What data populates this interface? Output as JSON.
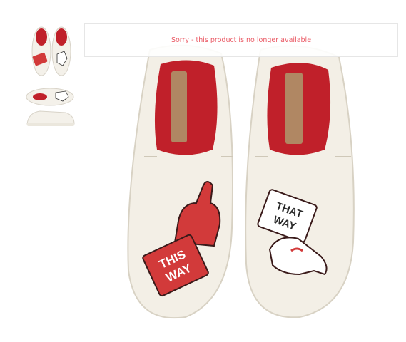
{
  "gallery": {
    "thumbnails": [
      {
        "name": "thumbnail-top-view"
      },
      {
        "name": "thumbnail-side-view"
      }
    ]
  },
  "notice": {
    "text": "Sorry - this product is no longer available",
    "color": "#ea5863"
  },
  "product": {
    "left_print": {
      "line1": "THIS",
      "line2": "WAY"
    },
    "right_print": {
      "line1": "THAT",
      "line2": "WAY"
    },
    "colors": {
      "canvas": "#f3efe6",
      "lining": "#c0202a",
      "print_red": "#d23a3a",
      "label": "#b08763"
    }
  }
}
